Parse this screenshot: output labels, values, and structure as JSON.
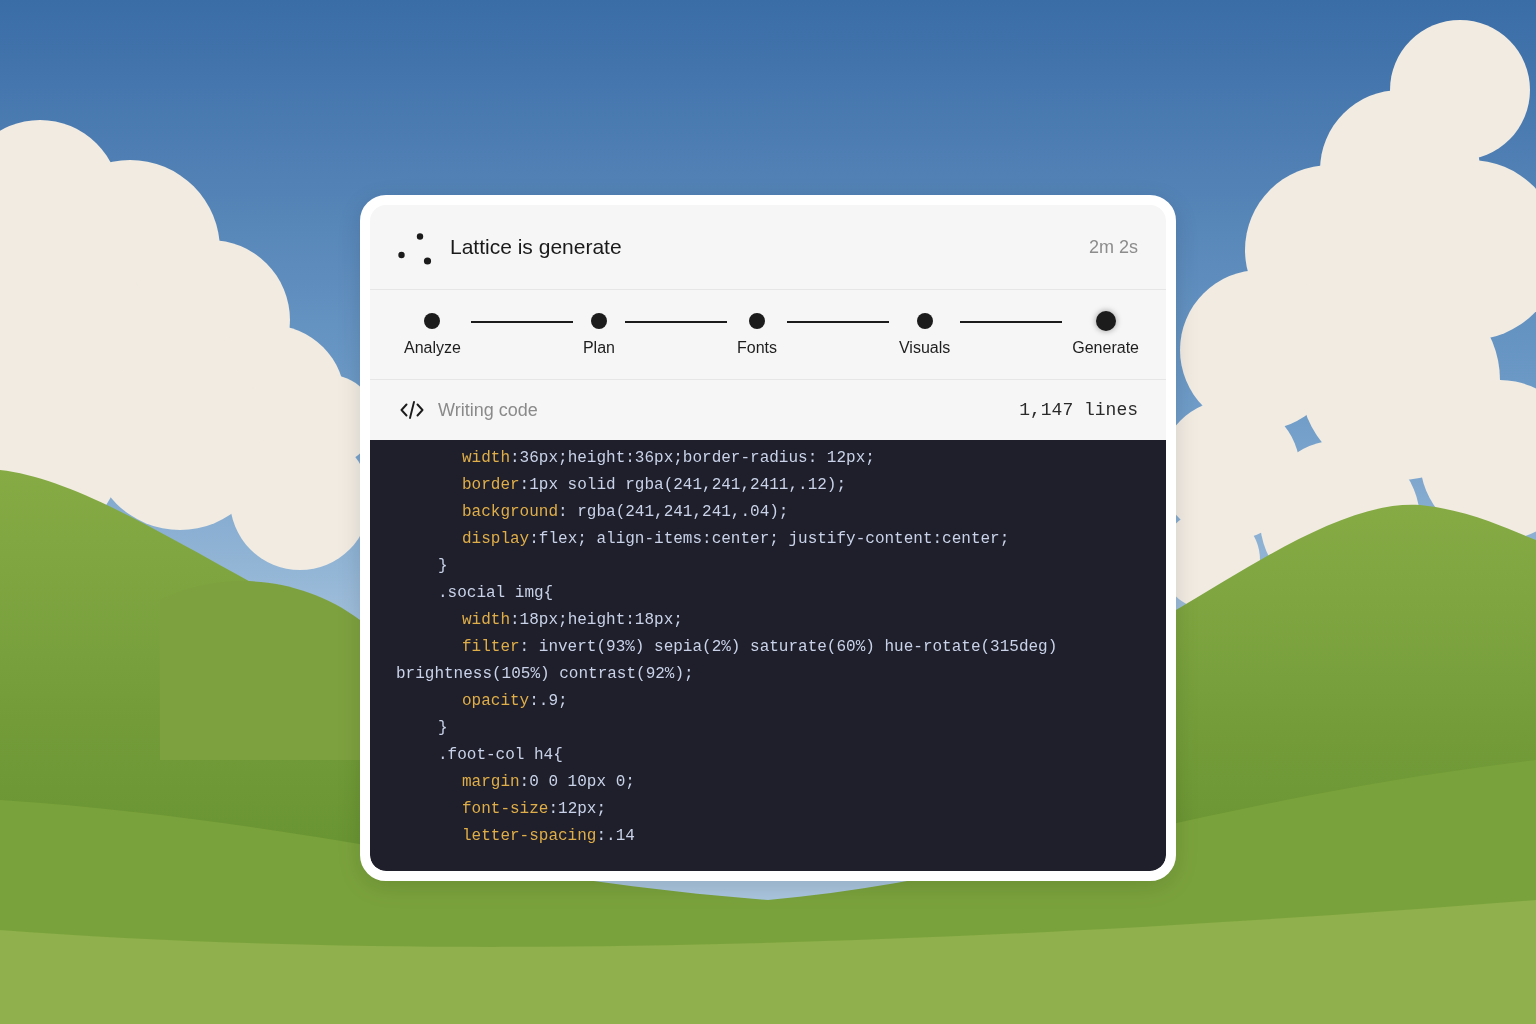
{
  "header": {
    "title": "Lattice is generate",
    "elapsed": "2m 2s"
  },
  "steps": [
    {
      "label": "Analyze",
      "current": false
    },
    {
      "label": "Plan",
      "current": false
    },
    {
      "label": "Fonts",
      "current": false
    },
    {
      "label": "Visuals",
      "current": false
    },
    {
      "label": "Generate",
      "current": true
    }
  ],
  "status": {
    "label": "Writing code",
    "line_count": "1,147 lines"
  },
  "code": {
    "lines": [
      {
        "kind": "declaration",
        "property": "width",
        "value": ":36px;height:36px;border-radius: 12px;"
      },
      {
        "kind": "declaration",
        "property": "border",
        "value": ":1px solid rgba(241,241,2411,.12);"
      },
      {
        "kind": "declaration",
        "property": "background",
        "value": ": rgba(241,241,241,.04);"
      },
      {
        "kind": "declaration",
        "property": "display",
        "value": ":flex; align-items:center; justify-content:center;"
      },
      {
        "kind": "rule",
        "text": "}"
      },
      {
        "kind": "rule",
        "text": ".social img{"
      },
      {
        "kind": "declaration",
        "property": "width",
        "value": ":18px;height:18px;"
      },
      {
        "kind": "declaration",
        "property": "filter",
        "value": ": invert(93%) sepia(2%) saturate(60%) hue-rotate(315deg)"
      },
      {
        "kind": "continuation",
        "text": "brightness(105%) contrast(92%);"
      },
      {
        "kind": "declaration",
        "property": "opacity",
        "value": ":.9;"
      },
      {
        "kind": "rule",
        "text": "}"
      },
      {
        "kind": "rule",
        "text": ".foot-col h4{"
      },
      {
        "kind": "declaration",
        "property": "margin",
        "value": ":0 0 10px 0;"
      },
      {
        "kind": "declaration",
        "property": "font-size",
        "value": ":12px;"
      },
      {
        "kind": "declaration",
        "property": "letter-spacing",
        "value": ":.14"
      }
    ]
  }
}
